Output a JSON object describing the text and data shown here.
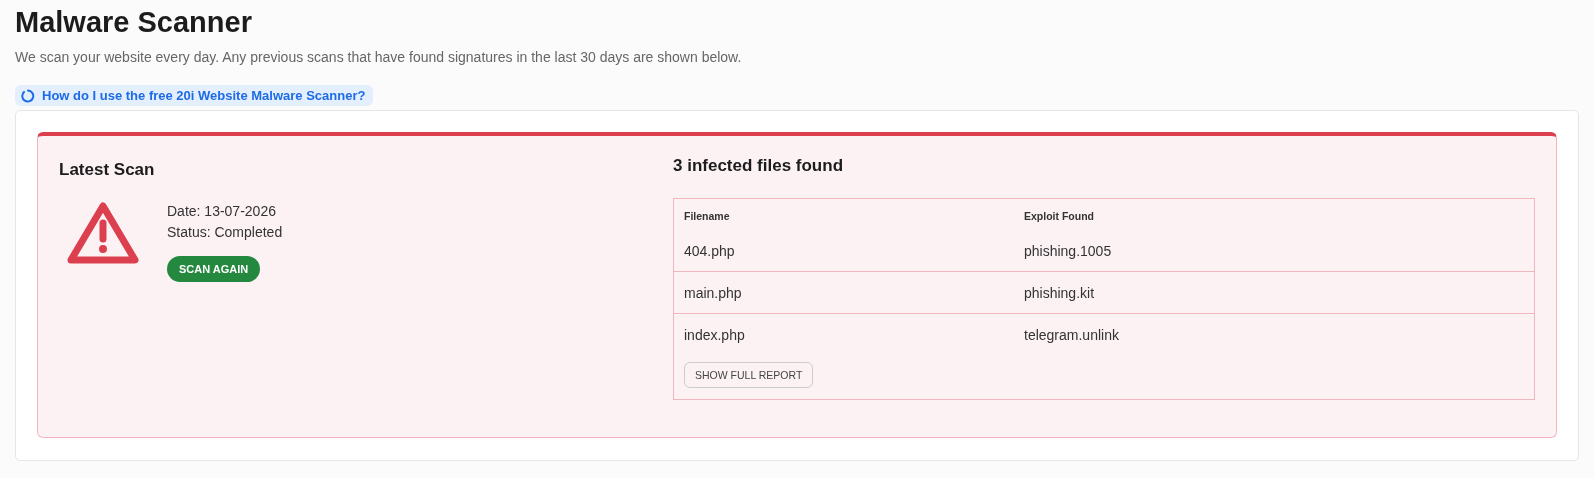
{
  "page": {
    "title": "Malware Scanner",
    "description": "We scan your website every day. Any previous scans that have found signatures in the last 30 days are shown below.",
    "help_link": "How do I use the free 20i Website Malware Scanner?"
  },
  "latest_scan": {
    "heading": "Latest Scan",
    "date": "Date: 13-07-2026",
    "status": "Status: Completed",
    "button": "SCAN AGAIN"
  },
  "results": {
    "heading": "3 infected files found",
    "columns": [
      "Filename",
      "Exploit Found"
    ],
    "rows": [
      {
        "filename": "404.php",
        "exploit": "phishing.1005"
      },
      {
        "filename": "main.php",
        "exploit": "phishing.kit"
      },
      {
        "filename": "index.php",
        "exploit": "telegram.unlink"
      }
    ],
    "button": "SHOW FULL REPORT"
  }
}
